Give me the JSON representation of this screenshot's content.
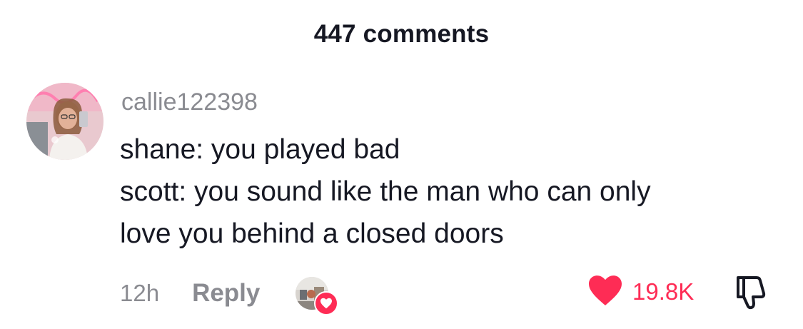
{
  "header": {
    "title": "447 comments"
  },
  "comment": {
    "username": "callie122398",
    "lines": [
      "shane: you played bad",
      "scott: you sound like the man who can only",
      "love you behind a closed doors"
    ],
    "timestamp": "12h",
    "reply_label": "Reply",
    "like_count": "19.8K",
    "liked": true,
    "liked_by_creator": true
  },
  "icons": {
    "like": "heart-filled-icon",
    "dislike": "thumbs-down-icon",
    "creator_like_badge": "heart-icon"
  },
  "colors": {
    "accent": "#fe2c55",
    "text_primary": "#161823",
    "text_secondary": "#8a8b91",
    "background": "#ffffff"
  }
}
